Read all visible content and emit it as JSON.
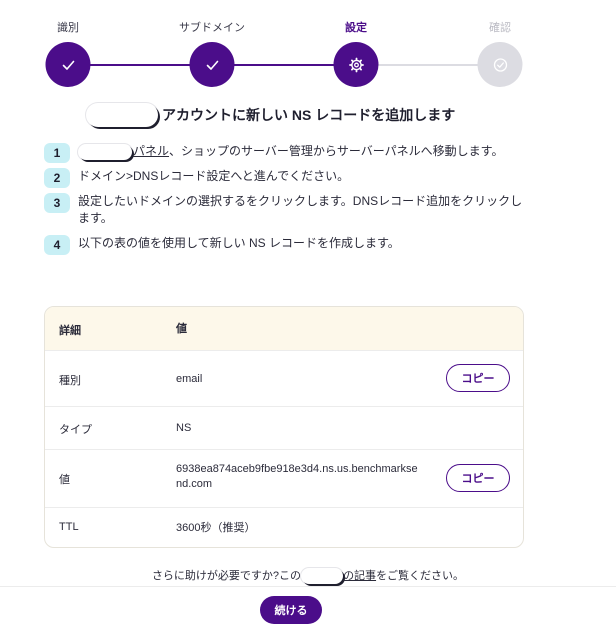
{
  "stepper": {
    "steps": [
      {
        "label": "識別",
        "state": "done",
        "icon": "check-icon"
      },
      {
        "label": "サブドメイン",
        "state": "done",
        "icon": "check-icon"
      },
      {
        "label": "設定",
        "state": "current",
        "icon": "gear-icon"
      },
      {
        "label": "確認",
        "state": "pending",
        "icon": "check-circle-icon"
      }
    ],
    "colors": {
      "accent": "#4b0d8a",
      "pending": "#dcdce2"
    }
  },
  "heading": {
    "text": "アカウントに新しい NS レコードを追加します"
  },
  "instructions": [
    {
      "num": "1",
      "link": "パネル",
      "text": "、ショップのサーバー管理からサーバーパネルへ移動します。"
    },
    {
      "num": "2",
      "text": "ドメイン>DNSレコード設定へと進んでください。"
    },
    {
      "num": "3",
      "text": "設定したいドメインの選択するをクリックします。DNSレコード追加をクリックします。"
    },
    {
      "num": "4",
      "text": "以下の表の値を使用して新しい NS レコードを作成します。"
    }
  ],
  "table": {
    "headers": [
      "詳細",
      "値"
    ],
    "rows": [
      {
        "label": "種別",
        "value": "email",
        "copy": true
      },
      {
        "label": "タイプ",
        "value": "NS",
        "copy": false
      },
      {
        "label": "値",
        "value": "6938ea874aceb9fbe918e3d4.ns.us.benchmarksend.com",
        "copy": true
      },
      {
        "label": "TTL",
        "value": "3600秒（推奨）",
        "copy": false
      }
    ],
    "copy_label": "コピー"
  },
  "footer": {
    "help_before": "さらに助けが必要ですか?この",
    "help_link": "の記事",
    "help_after": "をご覧ください。",
    "continue_label": "続ける"
  }
}
